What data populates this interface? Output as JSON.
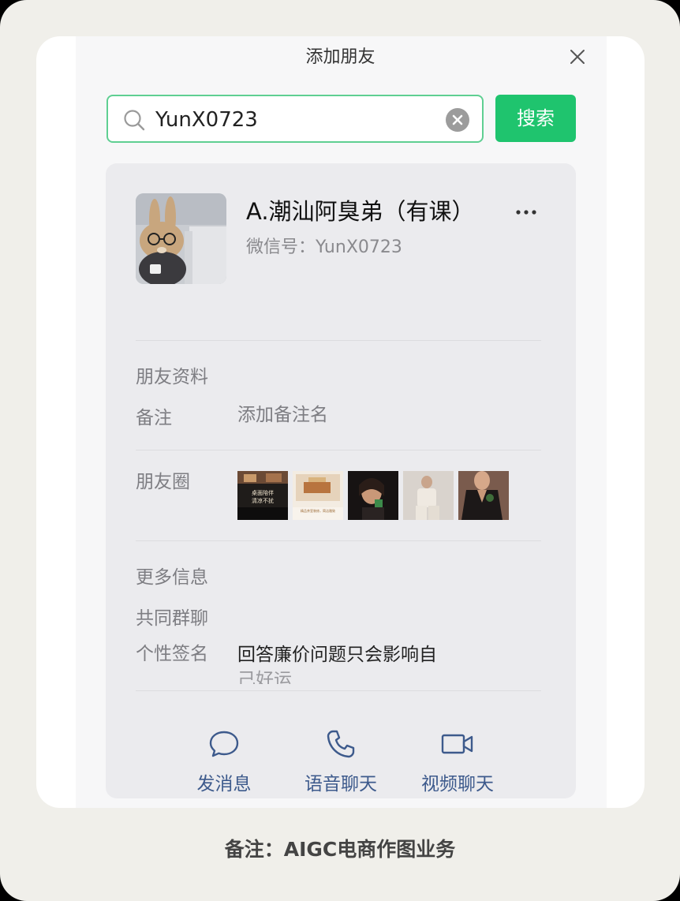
{
  "window": {
    "title": "添加朋友"
  },
  "search": {
    "value": "YunX0723",
    "button_label": "搜索"
  },
  "profile": {
    "name": "A.潮汕阿臭弟（有课）",
    "wechat_id_label": "微信号：",
    "wechat_id": "YunX0723"
  },
  "friend_info": {
    "section_title": "朋友资料",
    "remark_label": "备注",
    "remark_placeholder": "添加备注名"
  },
  "moments": {
    "label": "朋友圈",
    "thumb1_line1": "桌面陪伴",
    "thumb1_line2": "清凉不扰",
    "thumb2_caption": "精品茶室装修，简洁雅致"
  },
  "more_info": {
    "section_title": "更多信息",
    "common_groups_label": "共同群聊",
    "signature_label": "个性签名",
    "signature_line1": "回答廉价问题只会影响自",
    "signature_line2": "己好运"
  },
  "actions": {
    "message": "发消息",
    "voice": "语音聊天",
    "video": "视频聊天"
  },
  "footer": {
    "text": "备注：AIGC电商作图业务"
  },
  "colors": {
    "accent_green": "#1fc46e",
    "search_border": "#5fcf92",
    "action_blue": "#3d5a8c",
    "card_bg": "#ebebee"
  },
  "icons": [
    "close-icon",
    "search-icon",
    "clear-icon",
    "more-icon",
    "chat-bubble-icon",
    "phone-icon",
    "video-camera-icon"
  ]
}
